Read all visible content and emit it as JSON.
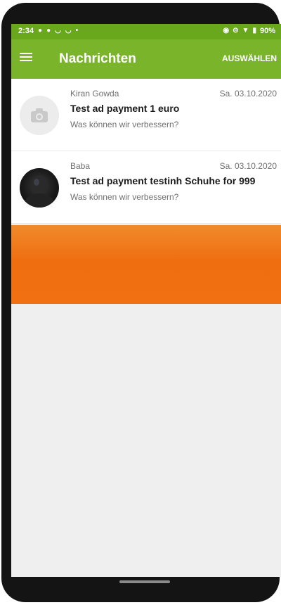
{
  "status_bar": {
    "time": "2:34",
    "battery": "90%"
  },
  "toolbar": {
    "title": "Nachrichten",
    "select_label": "AUSWÄHLEN"
  },
  "messages": [
    {
      "sender": "Kiran Gowda",
      "date": "Sa. 03.10.2020",
      "subject": "Test ad payment 1 euro",
      "preview": "Was können wir verbessern?",
      "avatar": "camera-placeholder-icon"
    },
    {
      "sender": "Baba",
      "date": "Sa. 03.10.2020",
      "subject": "Test ad payment testinh Schuhe for 999",
      "preview": "Was können wir verbessern?",
      "avatar": "user-photo"
    }
  ],
  "colors": {
    "status_bar": "#69a81d",
    "toolbar": "#7ab42a",
    "banner": "#ef6f10"
  }
}
